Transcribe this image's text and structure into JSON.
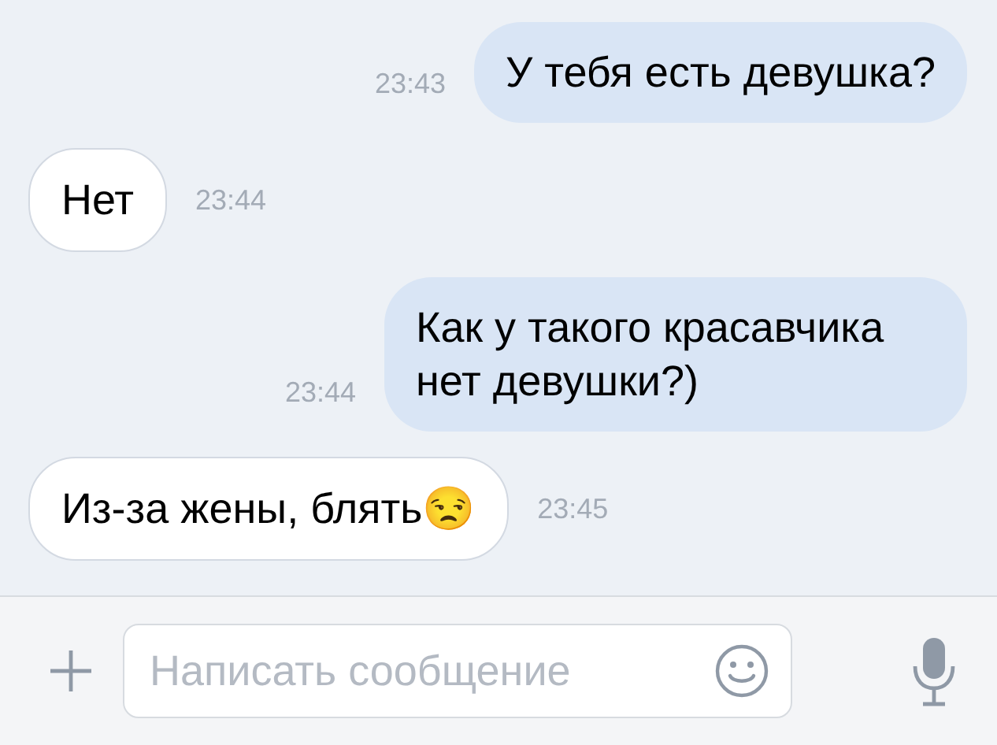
{
  "messages": [
    {
      "kind": "out",
      "text": "У тебя есть девушка?",
      "time": "23:43"
    },
    {
      "kind": "in",
      "text": "Нет",
      "time": "23:44"
    },
    {
      "kind": "out",
      "text": "Как у такого красавчика нет девушки?)",
      "time": "23:44"
    },
    {
      "kind": "in",
      "text": "Из-за жены, блять😒",
      "time": "23:45"
    }
  ],
  "composer": {
    "placeholder": "Написать сообщение"
  }
}
